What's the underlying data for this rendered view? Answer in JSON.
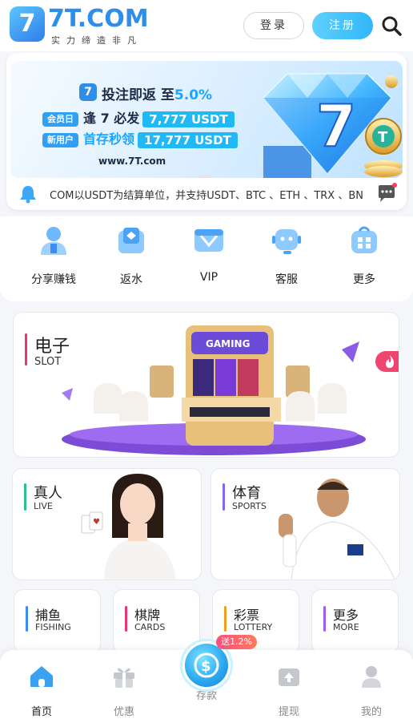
{
  "header": {
    "logo_text": "7T.COM",
    "logo_sub": "实力缔造非凡",
    "login_label": "登录",
    "register_label": "注册",
    "search_icon": "search-icon"
  },
  "banner": {
    "headline": "投注即返 至5.0%",
    "headline_prefix": "投注即返 至",
    "headline_percent": "5.0%",
    "row1_tag": "会员日",
    "row1_text": "逢 7 必发",
    "row1_amount": "7,777   USDT",
    "row2_tag": "新用户",
    "row2_text": "首存秒领",
    "row2_amount": "17,777 USDT",
    "url": "www.7T.com"
  },
  "marquee": {
    "text": "COM以USDT为结算单位，并支持USDT、BTC 、ETH 、TRX 、BN"
  },
  "quicknav": [
    {
      "label": "分享赚钱",
      "icon": "share-earn-icon"
    },
    {
      "label": "返水",
      "icon": "rebate-icon"
    },
    {
      "label": "VIP",
      "icon": "vip-icon"
    },
    {
      "label": "客服",
      "icon": "support-icon"
    },
    {
      "label": "更多",
      "icon": "more-icon"
    }
  ],
  "games": {
    "slot": {
      "title": "电子",
      "sub": "SLOT",
      "badge": "GAMING",
      "accent": "#e8366f"
    },
    "live": {
      "title": "真人",
      "sub": "LIVE",
      "accent": "#28c28a"
    },
    "sports": {
      "title": "体育",
      "sub": "SPORTS",
      "accent": "#7c6cf2"
    },
    "fishing": {
      "title": "捕鱼",
      "sub": "FISHING",
      "accent": "#3a8df0"
    },
    "cards": {
      "title": "棋牌",
      "sub": "CARDS",
      "accent": "#e8366f"
    },
    "lottery": {
      "title": "彩票",
      "sub": "LOTTERY",
      "accent": "#f0a020"
    },
    "more": {
      "title": "更多",
      "sub": "MORE",
      "accent": "#a35cf2"
    }
  },
  "bottomnav": {
    "home": "首页",
    "promo": "优惠",
    "deposit": "存款",
    "withdraw": "提现",
    "mine": "我的",
    "deposit_bonus": "送1.2%"
  },
  "colors": {
    "brand": "#2f8fe8",
    "register_button": "#30b6f7",
    "active_nav": "#3aa2f0"
  }
}
